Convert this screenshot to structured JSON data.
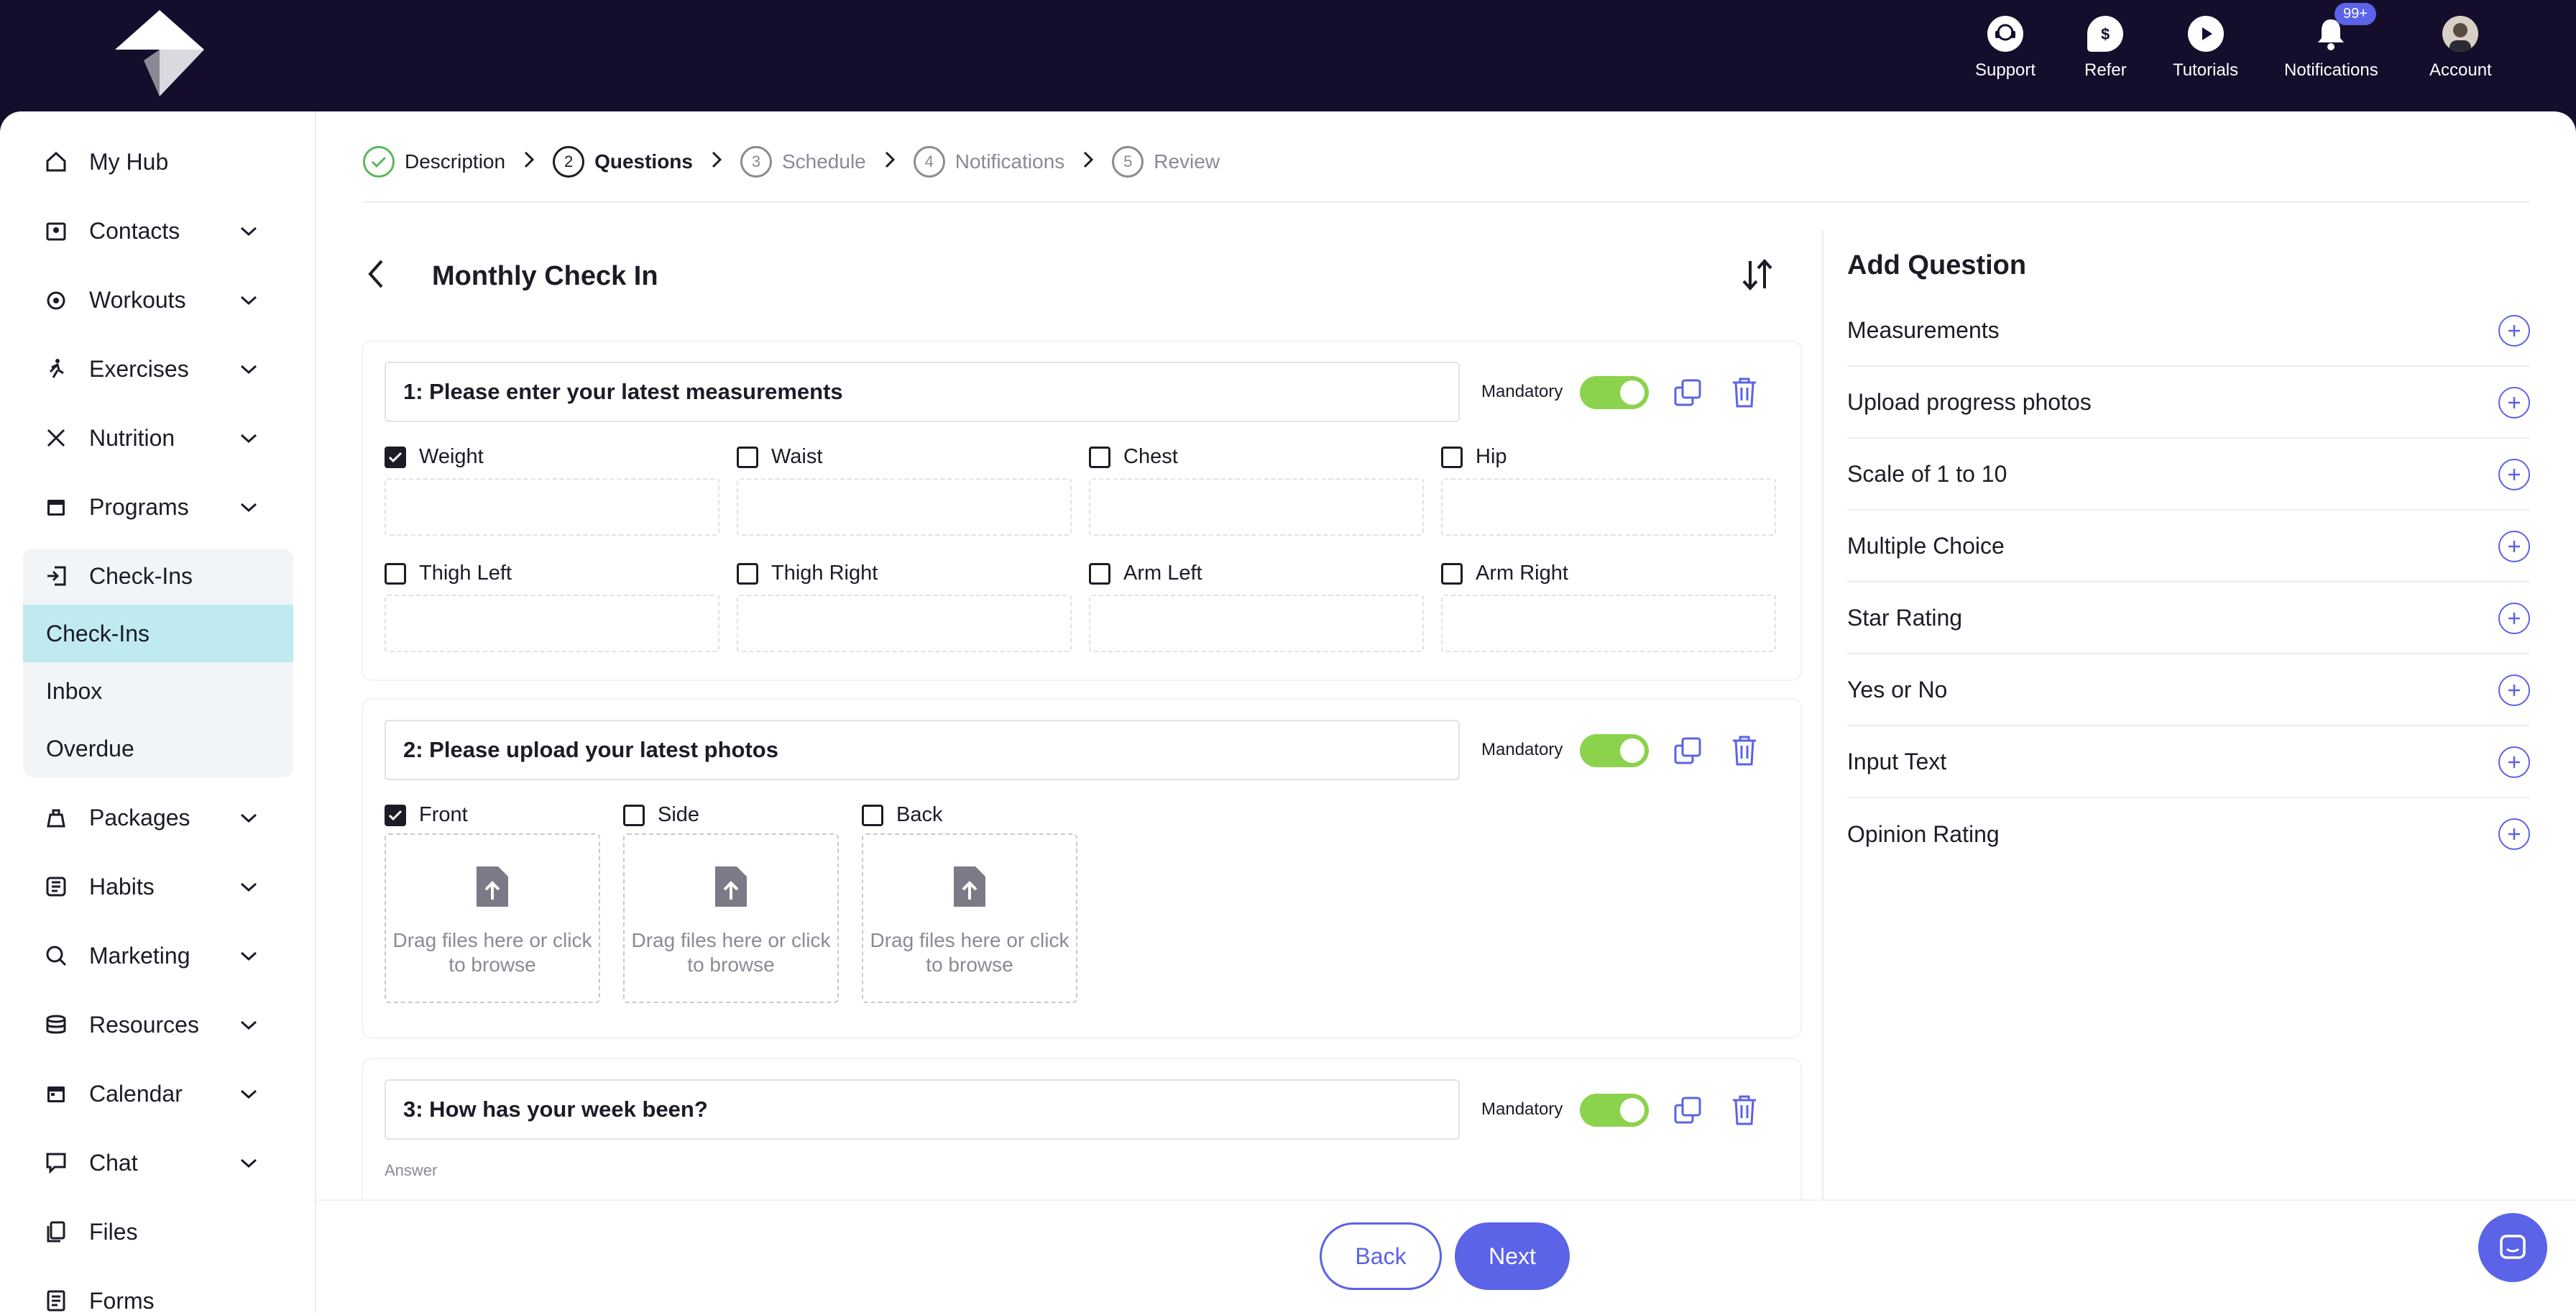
{
  "topnav": {
    "items": [
      {
        "label": "Support",
        "icon": "support-icon"
      },
      {
        "label": "Refer",
        "icon": "refer-icon"
      },
      {
        "label": "Tutorials",
        "icon": "play-icon"
      },
      {
        "label": "Notifications",
        "icon": "bell-icon"
      },
      {
        "label": "Account",
        "icon": "avatar"
      }
    ],
    "notifications_badge": "99+"
  },
  "sidebar": {
    "items": [
      {
        "label": "My Hub",
        "icon": "home-icon"
      },
      {
        "label": "Contacts",
        "icon": "contacts-icon"
      },
      {
        "label": "Workouts",
        "icon": "workouts-icon"
      },
      {
        "label": "Exercises",
        "icon": "exercises-icon"
      },
      {
        "label": "Nutrition",
        "icon": "nutrition-icon"
      },
      {
        "label": "Programs",
        "icon": "calendar-icon"
      },
      {
        "label": "Check-Ins",
        "icon": "checkin-icon"
      },
      {
        "label": "Packages",
        "icon": "packages-icon"
      },
      {
        "label": "Habits",
        "icon": "habits-icon"
      },
      {
        "label": "Marketing",
        "icon": "marketing-icon"
      },
      {
        "label": "Resources",
        "icon": "resources-icon"
      },
      {
        "label": "Calendar",
        "icon": "calendar-icon"
      },
      {
        "label": "Chat",
        "icon": "chat-icon"
      },
      {
        "label": "Files",
        "icon": "files-icon"
      },
      {
        "label": "Forms",
        "icon": "forms-icon"
      }
    ],
    "checkins_sub": [
      "Check-Ins",
      "Inbox",
      "Overdue"
    ]
  },
  "stepper": {
    "steps": [
      {
        "num": "1",
        "label": "Description",
        "state": "done"
      },
      {
        "num": "2",
        "label": "Questions",
        "state": "current"
      },
      {
        "num": "3",
        "label": "Schedule",
        "state": "pending"
      },
      {
        "num": "4",
        "label": "Notifications",
        "state": "pending"
      },
      {
        "num": "5",
        "label": "Review",
        "state": "pending"
      }
    ]
  },
  "form": {
    "title": "Monthly Check In",
    "mandatory_label": "Mandatory",
    "questions": [
      {
        "title": "1: Please enter your latest measurements",
        "mandatory": true,
        "options": [
          {
            "label": "Weight",
            "checked": true
          },
          {
            "label": "Waist",
            "checked": false
          },
          {
            "label": "Chest",
            "checked": false
          },
          {
            "label": "Hip",
            "checked": false
          },
          {
            "label": "Thigh Left",
            "checked": false
          },
          {
            "label": "Thigh Right",
            "checked": false
          },
          {
            "label": "Arm Left",
            "checked": false
          },
          {
            "label": "Arm Right",
            "checked": false
          }
        ]
      },
      {
        "title": "2: Please upload your latest photos",
        "mandatory": true,
        "options": [
          {
            "label": "Front",
            "checked": true
          },
          {
            "label": "Side",
            "checked": false
          },
          {
            "label": "Back",
            "checked": false
          }
        ],
        "upload_text": "Drag files here or click to browse"
      },
      {
        "title": "3: How has your week been?",
        "mandatory": true,
        "answer_label": "Answer"
      }
    ]
  },
  "add_question": {
    "title": "Add Question",
    "items": [
      "Measurements",
      "Upload progress photos",
      "Scale of 1 to 10",
      "Multiple Choice",
      "Star Rating",
      "Yes or No",
      "Input Text",
      "Opinion Rating"
    ]
  },
  "footer": {
    "back_label": "Back",
    "next_label": "Next"
  },
  "colors": {
    "accent": "#5b63e6",
    "toggle_on": "#8bd34d",
    "done": "#5cb85c",
    "header_bg": "#140d2b",
    "active_sub": "#bfeaf0"
  }
}
